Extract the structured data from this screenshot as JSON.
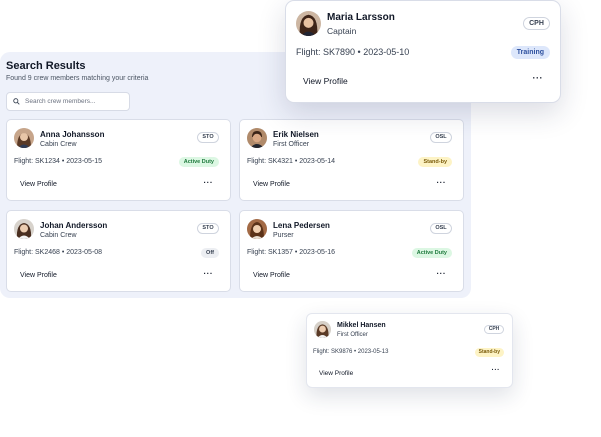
{
  "results": {
    "title": "Search Results",
    "subtitle": "Found 9 crew members matching your criteria",
    "search_placeholder": "Search crew members..."
  },
  "featured": {
    "name": "Maria Larsson",
    "role": "Captain",
    "base": "CPH",
    "flight": "Flight: SK7890 • 2023-05-10",
    "status": "Training",
    "action": "View Profile",
    "more": "···"
  },
  "crew": [
    {
      "name": "Anna Johansson",
      "role": "Cabin Crew",
      "base": "STO",
      "flight": "Flight: SK1234 • 2023-05-15",
      "status": "Active Duty",
      "action": "View Profile",
      "more": "···"
    },
    {
      "name": "Erik Nielsen",
      "role": "First Officer",
      "base": "OSL",
      "flight": "Flight: SK4321 • 2023-05-14",
      "status": "Stand-by",
      "action": "View Profile",
      "more": "···"
    },
    {
      "name": "Johan Andersson",
      "role": "Cabin Crew",
      "base": "STO",
      "flight": "Flight: SK2468 • 2023-05-08",
      "status": "Off",
      "action": "View Profile",
      "more": "···"
    },
    {
      "name": "Lena Pedersen",
      "role": "Purser",
      "base": "OSL",
      "flight": "Flight: SK1357 • 2023-05-16",
      "status": "Active Duty",
      "action": "View Profile",
      "more": "···"
    }
  ],
  "floating": {
    "name": "Mikkel Hansen",
    "role": "First Officer",
    "base": "CPH",
    "flight": "Flight: SK9876 • 2023-05-13",
    "status": "Stand-by",
    "action": "View Profile",
    "more": "···"
  },
  "status_colors": {
    "Active Duty": "#dcf7e3",
    "Stand-by": "#fdf3c5",
    "Off": "#eceef2",
    "Training": "#dde7fb"
  },
  "icons": {
    "search": "search-icon",
    "avatar": "avatar-photo"
  }
}
